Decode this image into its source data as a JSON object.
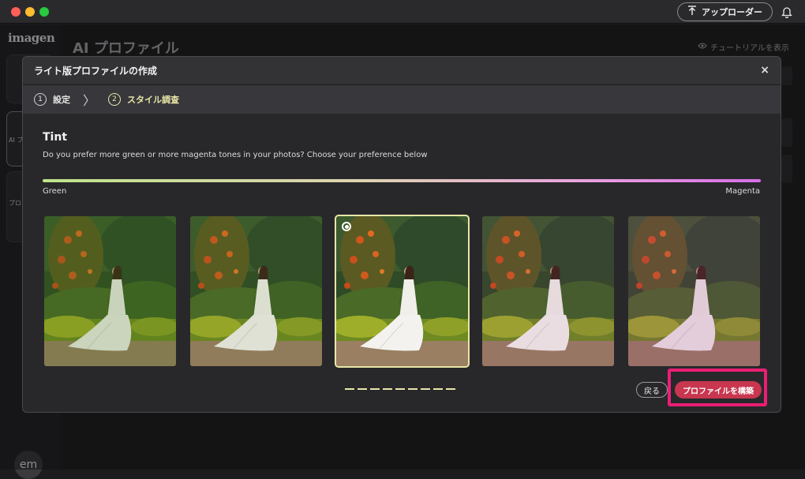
{
  "app": {
    "uploader_label": "アップローダー",
    "logo": "imagen",
    "avatar_initials": "em"
  },
  "page": {
    "title": "AI プロファイル",
    "tutorial_label": "チュートリアルを表示"
  },
  "sidebar": {
    "items": [
      {
        "label": "AI プ"
      },
      {
        "label": "プロ"
      }
    ]
  },
  "modal": {
    "title": "ライト版プロファイルの作成",
    "close_glyph": "×",
    "steps": [
      {
        "number": "1",
        "label": "設定",
        "active": false
      },
      {
        "number": "2",
        "label": "スタイル調査",
        "active": true
      }
    ],
    "step_separator": "〉",
    "section": {
      "heading": "Tint",
      "description": "Do you prefer more green or more magenta tones in your photos? Choose your preference below",
      "left_label": "Green",
      "right_label": "Magenta"
    },
    "photos": [
      {
        "tint": "green-strong",
        "selected": false
      },
      {
        "tint": "green",
        "selected": false
      },
      {
        "tint": "neutral",
        "selected": true
      },
      {
        "tint": "magenta",
        "selected": false
      },
      {
        "tint": "magenta-strong",
        "selected": false
      }
    ],
    "progress_dashes": 9,
    "back_label": "戻る",
    "build_label": "プロファイルを構築"
  },
  "colors": {
    "accent_yellow": "#e8e6a8",
    "build_button": "#c8364f",
    "highlight_box": "#ea1f73"
  }
}
